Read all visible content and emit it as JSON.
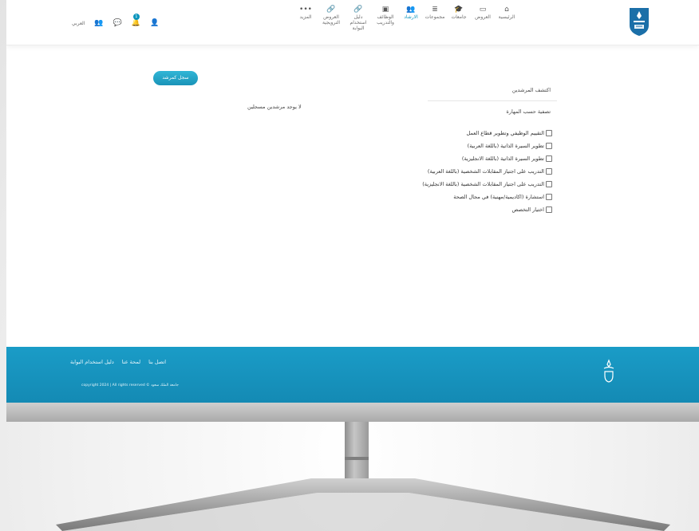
{
  "header": {
    "nav": [
      {
        "id": "home",
        "icon": "home-icon",
        "glyph": "⌂",
        "label": "الرئيسية",
        "active": false
      },
      {
        "id": "offers",
        "icon": "card-icon",
        "glyph": "▭",
        "label": "العروض",
        "active": false
      },
      {
        "id": "universities",
        "icon": "graduation-cap-icon",
        "glyph": "🎓",
        "label": "جامعات",
        "active": false
      },
      {
        "id": "groups",
        "icon": "list-icon",
        "glyph": "≣",
        "label": "مجموعات",
        "active": false
      },
      {
        "id": "guidance",
        "icon": "mentors-icon",
        "glyph": "👥",
        "label": "الارشاد",
        "active": true
      },
      {
        "id": "jobs",
        "icon": "briefcase-icon",
        "glyph": "▣",
        "label": "الوظائف والتدريب",
        "active": false
      },
      {
        "id": "portal_guide",
        "icon": "link-icon",
        "glyph": "🔗",
        "label": "دليل استخدام البوابة",
        "active": false
      },
      {
        "id": "promo",
        "icon": "link-icon",
        "glyph": "🔗",
        "label": "العروض الترويجية",
        "active": false
      },
      {
        "id": "more",
        "icon": "more-icon",
        "glyph": "•••",
        "label": "المزيد",
        "active": false
      }
    ],
    "tools": {
      "language_label": "العربي",
      "notification_count": "1"
    }
  },
  "main": {
    "register_button": "سجل كمرشد",
    "panel_title": "اكتشف المرشدين",
    "filter_title": "تصفية حسب المهارة",
    "no_mentors": "لا يوجد مرشدين مسجلين",
    "skills": [
      "التقييم الوظيفي وتطوير قطاع العمل",
      "تطوير السيرة الذاتية (باللغة العربية)",
      "تطوير السيرة الذاتية (باللغة الانجليزية)",
      "التدريب على اجتياز المقابلات الشخصية (باللغة العربية)",
      "التدريب على اجتياز المقابلات الشخصية (باللغة الانجليزية)",
      "استشارة (اكاديمية/مهنية) في مجال الصحة",
      "اختيار التخصص"
    ]
  },
  "footer": {
    "links": [
      "اتصل بنا",
      "لمحة عنا",
      "دليل استخدام البوابة"
    ],
    "copyright": "copyright 2024 | All rights reserved © جامعة الملك سعود"
  },
  "colors": {
    "accent": "#0a94bd",
    "footer": "#1a9cc7",
    "logo": "#1b6fa8"
  }
}
